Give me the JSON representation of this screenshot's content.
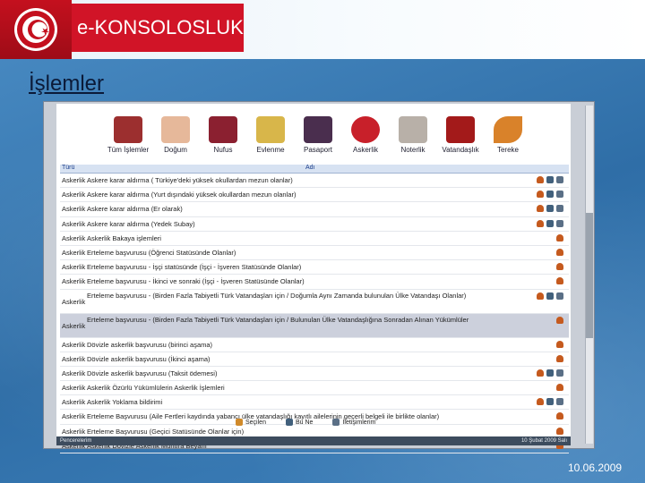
{
  "header": {
    "title": "e-KONSOLOSLUK",
    "logo_text": "T.C. DIŞİŞLERİ BAKANLIĞI"
  },
  "subtitle": "İşlemler",
  "toolbar": {
    "items": [
      {
        "label": "Tüm İşlemler",
        "icon": "books-icon",
        "color": "#9c2f2f"
      },
      {
        "label": "Doğum",
        "icon": "baby-icon",
        "color": "#e6b89a"
      },
      {
        "label": "Nufus",
        "icon": "id-card-icon",
        "color": "#8b2030"
      },
      {
        "label": "Evlenme",
        "icon": "rings-icon",
        "color": "#d8b64a"
      },
      {
        "label": "Pasaport",
        "icon": "passport-icon",
        "color": "#4a2e4e"
      },
      {
        "label": "Askerlik",
        "icon": "soldier-icon",
        "color": "#c8202a"
      },
      {
        "label": "Noterlik",
        "icon": "document-icon",
        "color": "#b8b0a8"
      },
      {
        "label": "Vatandaşlık",
        "icon": "people-icon",
        "color": "#a31a1a"
      },
      {
        "label": "Tereke",
        "icon": "leaf-icon",
        "color": "#d9822a"
      }
    ]
  },
  "grid": {
    "headers": {
      "type": "Türü",
      "name": "Adı"
    },
    "rows": [
      {
        "type": "Askerlik",
        "name": "Askere karar aldırma ( Türkiye'deki yüksek okullardan mezun olanlar)",
        "actions": 3
      },
      {
        "type": "Askerlik",
        "name": "Askere karar aldırma (Yurt dışındaki yüksek okullardan mezun olanlar)",
        "actions": 3
      },
      {
        "type": "Askerlik",
        "name": "Askere karar aldırma (Er olarak)",
        "actions": 3
      },
      {
        "type": "Askerlik",
        "name": "Askere karar aldırma (Yedek Subay)",
        "actions": 3
      },
      {
        "type": "Askerlik",
        "name": "Askerlik Bakaya işlemleri",
        "actions": 1
      },
      {
        "type": "Askerlik",
        "name": "Erteleme başvurusu (Öğrenci Statüsünde Olanlar)",
        "actions": 1
      },
      {
        "type": "Askerlik",
        "name": "Erteleme başvurusu - İşçi statüsünde (İşçi - İşveren Statüsünde Olanlar)",
        "actions": 1
      },
      {
        "type": "Askerlik",
        "name": "Erteleme başvurusu - İkinci ve sonraki (İşçi - İşveren Statüsünde Olanlar)",
        "actions": 1
      },
      {
        "type": "Askerlik",
        "name": "Erteleme başvurusu - (Birden Fazla Tabiyetli Türk Vatandaşları için / Doğumla Aynı Zamanda bulunulan Ülke Vatandaşı Olanlar)",
        "actions": 3,
        "tall": true
      },
      {
        "type": "Askerlik",
        "name": "Erteleme başvurusu - (Birden Fazla Tabiyetli Türk Vatandaşları için / Bulunulan Ülke Vatandaşlığına Sonradan Alınan Yükümlüler",
        "actions": 1,
        "tall": true,
        "selected": true
      },
      {
        "type": "Askerlik",
        "name": "Dövizle askerlik başvurusu (birinci aşama)",
        "actions": 1
      },
      {
        "type": "Askerlik",
        "name": "Dövizle askerlik başvurusu (İkinci aşama)",
        "actions": 1
      },
      {
        "type": "Askerlik",
        "name": "Dövizle askerlik başvurusu (Taksit ödemesi)",
        "actions": 3
      },
      {
        "type": "Askerlik",
        "name": "Askerlik Özürlü Yükümlülerin Askerlik İşlemleri",
        "actions": 1
      },
      {
        "type": "Askerlik",
        "name": "Askerlik Yoklama bildirimi",
        "actions": 3
      },
      {
        "type": "Askerlik",
        "name": "Erteleme Başvurusu (Aile Fertleri kaydında yabancı ülke vatandaşlığı kayıtlı ailelerinin geçerli belgeli ile birlikte olanlar)",
        "actions": 1
      },
      {
        "type": "Askerlik",
        "name": "Erteleme Başvurusu (Geçici Statüsünde Olanlar için)",
        "actions": 1
      },
      {
        "type": "Askerlik",
        "name": "Askerlik Dövizle Askerlik Muhtıra Beyanı",
        "actions": 1
      }
    ]
  },
  "bottom_links": [
    "Seçilen",
    "Bu Ne",
    "İletişimlerim"
  ],
  "status_bar": {
    "left": "Pencerelerim",
    "right": "10 Şubat 2009 Salı"
  },
  "footer_date": "10.06.2009"
}
